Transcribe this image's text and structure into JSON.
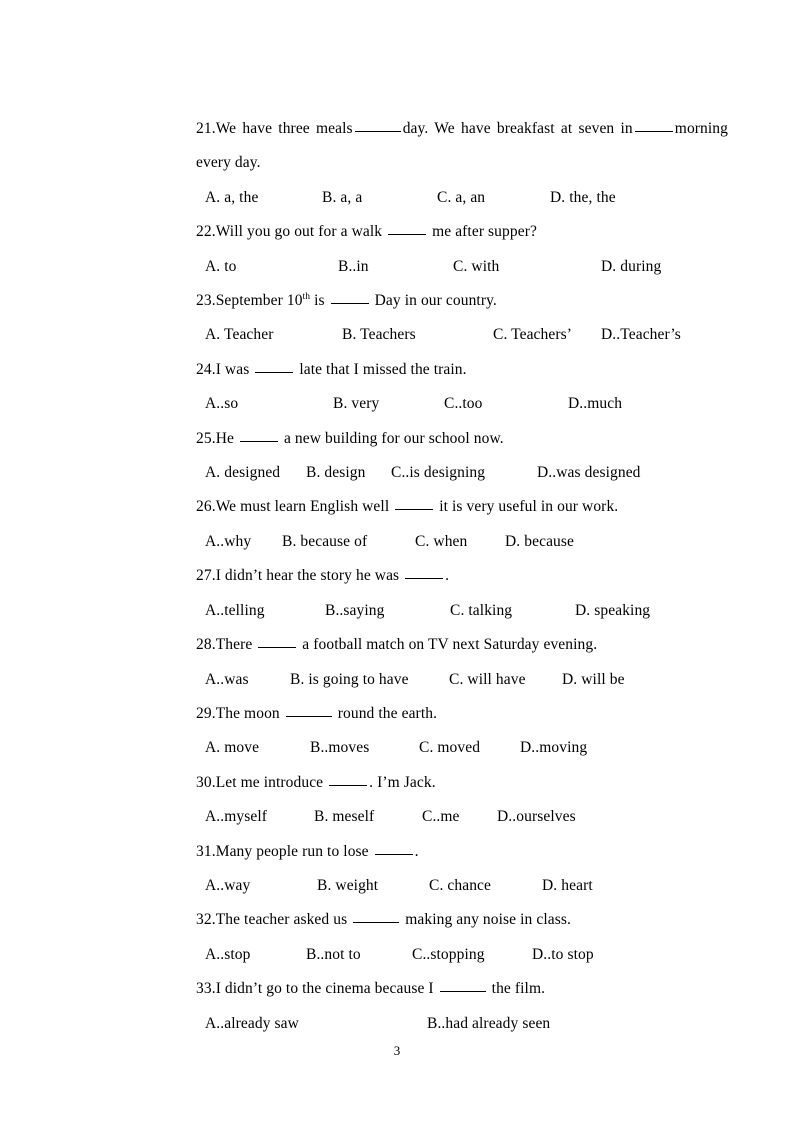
{
  "document": {
    "page_number": "3",
    "items": [
      {
        "id": "q21",
        "number": "21.",
        "stem_line1": "We have three meals",
        "stem_line1_mid": "day. We have breakfast at seven in",
        "stem_line1_end": "morning",
        "stem_line2": "every day.",
        "options": [
          {
            "label": "A.",
            "text": " a, the"
          },
          {
            "label": "B.",
            "text": " a, a"
          },
          {
            "label": "C.",
            "text": " a, an"
          },
          {
            "label": "D.",
            "text": " the, the"
          }
        ]
      },
      {
        "id": "q22",
        "number": "22.",
        "stem_pre": "Will  you go out for a walk",
        "stem_post": "me after supper?",
        "options": [
          {
            "label": "A.",
            "text": " to"
          },
          {
            "label": "B.",
            "text": ".in"
          },
          {
            "label": "C.",
            "text": " with"
          },
          {
            "label": "D.",
            "text": " during"
          }
        ]
      },
      {
        "id": "q23",
        "number": "23.",
        "stem_pre": "September 10",
        "stem_sup": "th",
        "stem_mid": " is",
        "stem_post": "Day in our country.",
        "options": [
          {
            "label": "A.",
            "text": " Teacher"
          },
          {
            "label": "B.",
            "text": " Teachers"
          },
          {
            "label": "C.",
            "text": " Teachers’"
          },
          {
            "label": "D.",
            "text": ".Teacher’s"
          }
        ]
      },
      {
        "id": "q24",
        "number": "24.",
        "stem_pre": "I was",
        "stem_post": "late that I missed the train.",
        "options": [
          {
            "label": "A.",
            "text": ".so"
          },
          {
            "label": "B.",
            "text": " very"
          },
          {
            "label": "C.",
            "text": ".too"
          },
          {
            "label": "D.",
            "text": ".much"
          }
        ]
      },
      {
        "id": "q25",
        "number": "25.",
        "stem_pre": "He",
        "stem_post": "a new building for our school now.",
        "options": [
          {
            "label": "A.",
            "text": " designed"
          },
          {
            "label": "B.",
            "text": " design"
          },
          {
            "label": "C.",
            "text": ".is designing"
          },
          {
            "label": "D.",
            "text": ".was designed"
          }
        ]
      },
      {
        "id": "q26",
        "number": "26.",
        "stem_pre": "We must learn English well",
        "stem_post": "it is very useful in our work.",
        "options": [
          {
            "label": "A.",
            "text": ".why"
          },
          {
            "label": "B.",
            "text": " because of"
          },
          {
            "label": "C.",
            "text": " when"
          },
          {
            "label": "D.",
            "text": " because"
          }
        ]
      },
      {
        "id": "q27",
        "number": "27.",
        "stem_pre": "I didn’t hear the story he was",
        "stem_post": ".",
        "options": [
          {
            "label": "A.",
            "text": ".telling"
          },
          {
            "label": "B.",
            "text": ".saying"
          },
          {
            "label": "C.",
            "text": " talking"
          },
          {
            "label": "D.",
            "text": " speaking"
          }
        ]
      },
      {
        "id": "q28",
        "number": "28.",
        "stem_pre": "There",
        "stem_post": "a football match on TV next Saturday evening.",
        "options": [
          {
            "label": "A.",
            "text": ".was"
          },
          {
            "label": "B.",
            "text": " is going to have"
          },
          {
            "label": "C.",
            "text": " will have"
          },
          {
            "label": "D.",
            "text": " will be"
          }
        ]
      },
      {
        "id": "q29",
        "number": "29.",
        "stem_pre": "The moon",
        "stem_post": "round the earth.",
        "options": [
          {
            "label": "A.",
            "text": " move"
          },
          {
            "label": "B.",
            "text": ".moves"
          },
          {
            "label": "C.",
            "text": " moved"
          },
          {
            "label": "D.",
            "text": ".moving"
          }
        ]
      },
      {
        "id": "q30",
        "number": "30.",
        "stem_pre": "Let me introduce",
        "stem_post": ". I’m Jack.",
        "options": [
          {
            "label": "A.",
            "text": ".myself"
          },
          {
            "label": "B.",
            "text": " meself"
          },
          {
            "label": "C.",
            "text": ".me"
          },
          {
            "label": "D.",
            "text": ".ourselves"
          }
        ]
      },
      {
        "id": "q31",
        "number": "31.",
        "stem_pre": "Many people run to lose",
        "stem_post": ".",
        "options": [
          {
            "label": "A.",
            "text": ".way"
          },
          {
            "label": "B.",
            "text": " weight"
          },
          {
            "label": "C.",
            "text": " chance"
          },
          {
            "label": "D.",
            "text": " heart"
          }
        ]
      },
      {
        "id": "q32",
        "number": "32.",
        "stem_pre": "The teacher asked us",
        "stem_post": "making any noise in class.",
        "options": [
          {
            "label": "A.",
            "text": ".stop"
          },
          {
            "label": "B.",
            "text": ".not to"
          },
          {
            "label": "C.",
            "text": ".stopping"
          },
          {
            "label": "D.",
            "text": ".to stop"
          }
        ]
      },
      {
        "id": "q33",
        "number": "33.",
        "stem_pre": "I didn’t go to the cinema because I",
        "stem_post": "the film.",
        "options": [
          {
            "label": "A.",
            "text": ".already saw"
          },
          {
            "label": "B.",
            "text": ".had already seen"
          }
        ]
      }
    ]
  }
}
